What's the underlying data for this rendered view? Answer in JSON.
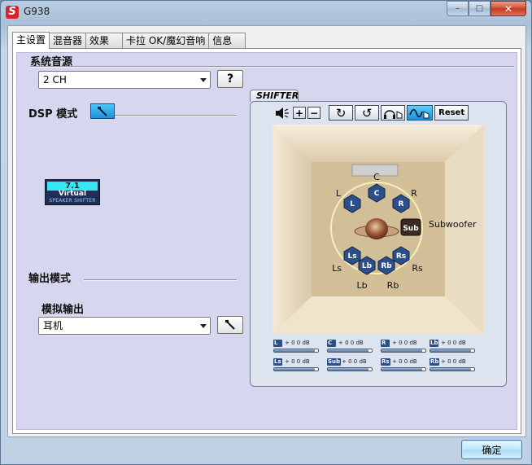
{
  "window": {
    "title": "G938",
    "logo_letter": "S",
    "minimize": "–",
    "maximize": "□",
    "close": "✕"
  },
  "tabs": [
    {
      "label": "主设置",
      "active": true
    },
    {
      "label": "混音器",
      "active": false
    },
    {
      "label": "效果",
      "active": false
    },
    {
      "label": "卡拉 OK/魔幻音响",
      "active": false
    },
    {
      "label": "信息",
      "active": false
    }
  ],
  "main": {
    "source_heading": "系统音源",
    "source_select": "2 CH",
    "help_button": "?",
    "dsp_heading": "DSP 模式",
    "virtual_badge": {
      "top": "7.1",
      "mid": "Virtual",
      "bottom": "SPEAKER SHIFTER"
    },
    "output_heading": "输出模式",
    "analog_heading": "模拟输出",
    "analog_select": "耳机"
  },
  "shifter": {
    "tab_label": "SHIFTER",
    "toolbar": {
      "volume_icon": "◀",
      "plus": "+",
      "minus": "−",
      "rotate_cw": "↻",
      "rotate_ccw": "↺",
      "headphone_icon": "🎧",
      "wave_icon": "∿",
      "reset": "Reset"
    },
    "speakers": {
      "C": "C",
      "L": "L",
      "R": "R",
      "Sub": "Sub",
      "Subwoofer": "Subwoofer",
      "Ls": "Ls",
      "Rs": "Rs",
      "Lb": "Lb",
      "Rb": "Rb"
    },
    "meters": [
      {
        "tag": "L",
        "value": "+ 0 0 dB",
        "level": 0.92
      },
      {
        "tag": "C",
        "value": "+ 0 0 dB",
        "level": 0.92
      },
      {
        "tag": "R",
        "value": "+ 0 0 dB",
        "level": 0.92
      },
      {
        "tag": "Lb",
        "value": "+ 0 0 dB",
        "level": 0.92
      },
      {
        "tag": "Ls",
        "value": "+ 0 0 dB",
        "level": 0.92
      },
      {
        "tag": "Sub",
        "value": "+ 0 0 dB",
        "level": 0.92
      },
      {
        "tag": "Rs",
        "value": "+ 0 0 dB",
        "level": 0.92
      },
      {
        "tag": "Rb",
        "value": "+ 0 0 dB",
        "level": 0.92
      }
    ]
  },
  "footer": {
    "ok": "确定"
  },
  "colors": {
    "accent": "#1c8fd8",
    "panel": "#d6d6ee",
    "speaker": "#2a4f8a"
  }
}
